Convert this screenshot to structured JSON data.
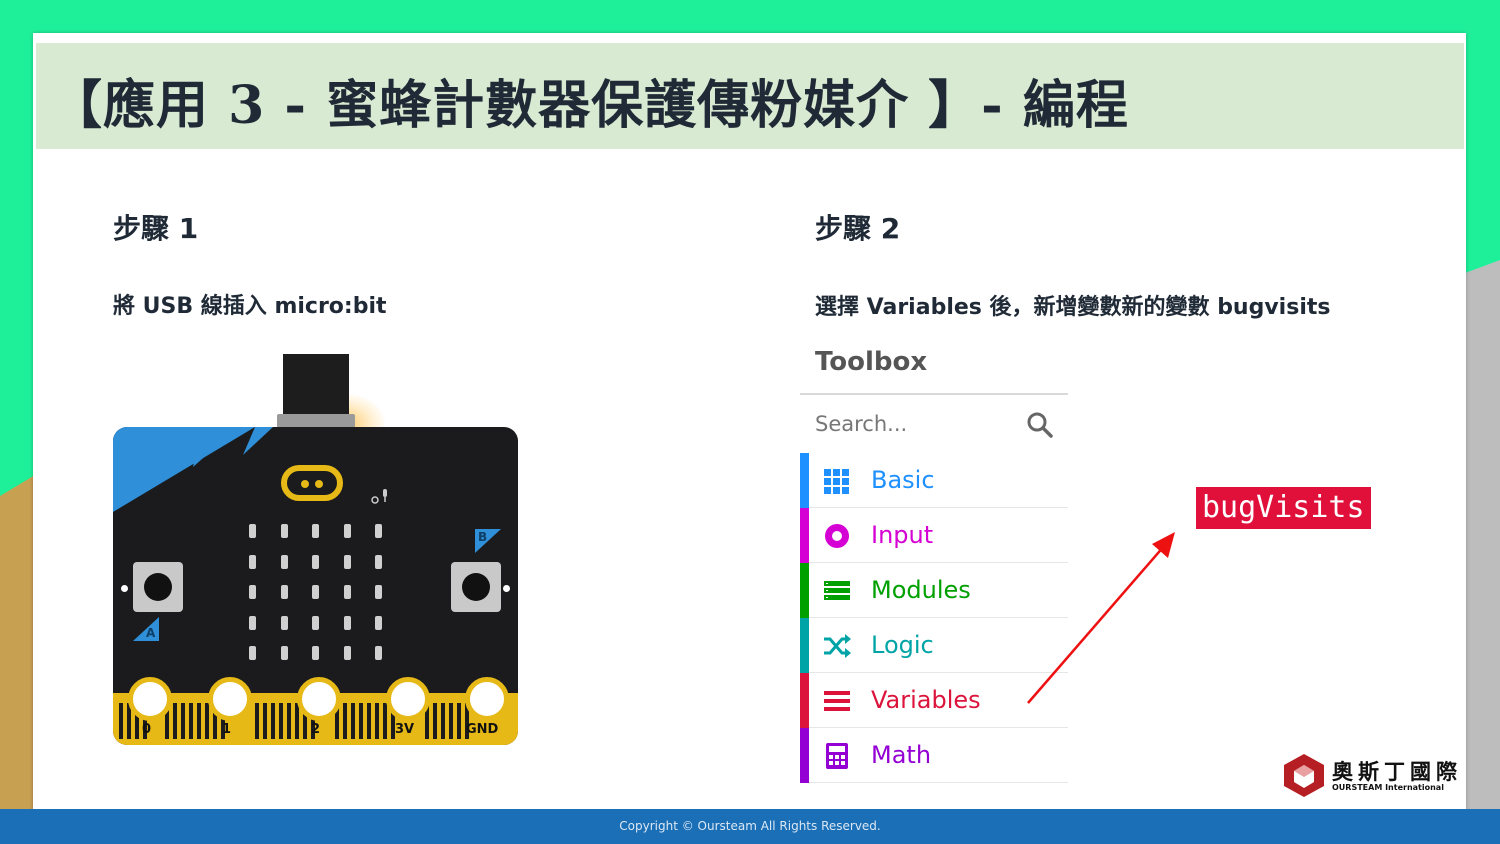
{
  "header": {
    "title": "【應用 3 - 蜜蜂計數器保護傳粉媒介 】- 編程"
  },
  "step1": {
    "heading": "步驟 1",
    "instruction": "將 USB 線插入 micro:bit"
  },
  "step2": {
    "heading": "步驟 2",
    "instruction": "選擇 Variables 後，新增變數新的變數 bugvisits"
  },
  "microbit": {
    "pins": [
      "0",
      "1",
      "2",
      "3V",
      "GND"
    ],
    "button_a": "A",
    "button_b": "B"
  },
  "toolbox": {
    "title": "Toolbox",
    "search_placeholder": "Search...",
    "categories": [
      {
        "label": "Basic",
        "color": "#1e90ff",
        "icon": "grid-icon"
      },
      {
        "label": "Input",
        "color": "#d400d4",
        "icon": "radio-dot-icon"
      },
      {
        "label": "Modules",
        "color": "#00a000",
        "icon": "stack-icon"
      },
      {
        "label": "Logic",
        "color": "#00a4a6",
        "icon": "shuffle-icon"
      },
      {
        "label": "Variables",
        "color": "#dc143c",
        "icon": "lines-icon"
      },
      {
        "label": "Math",
        "color": "#9400d3",
        "icon": "calculator-icon"
      }
    ]
  },
  "variable_tag": "bugVisits",
  "brand": {
    "name_cn": "奧斯丁國際",
    "name_en": "OURSTEAM International"
  },
  "footer": {
    "copyright": "Copyright © Oursteam All Rights Reserved."
  }
}
